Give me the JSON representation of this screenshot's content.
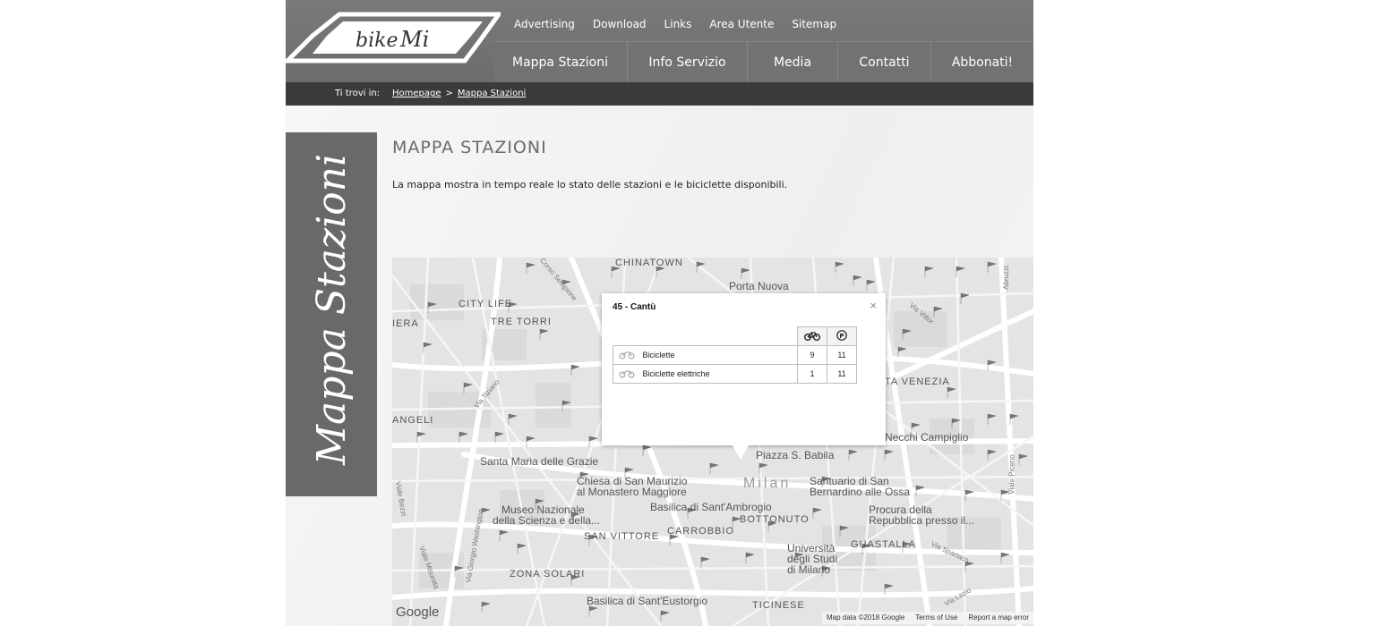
{
  "logo": {
    "text_bike": "bike",
    "text_mi": "Mi"
  },
  "top_nav": [
    "Advertising",
    "Download",
    "Links",
    "Area Utente",
    "Sitemap"
  ],
  "main_nav": [
    "Mappa Stazioni",
    "Info Servizio",
    "Media",
    "Contatti",
    "Abbonati!"
  ],
  "breadcrumb": {
    "label": "Ti trovi in:",
    "items": [
      "Homepage",
      "Mappa Stazioni"
    ],
    "separator": ">"
  },
  "side_banner": {
    "text": "Mappa Stazioni"
  },
  "page": {
    "title": "MAPPA STAZIONI",
    "intro": "La mappa mostra in tempo reale lo stato delle stazioni e le biciclette disponibili."
  },
  "map": {
    "labels": {
      "chinatown": "CHINATOWN",
      "porta_nuova": "Porta Nuova",
      "city_life": "CITY LIFE",
      "tre_torri": "TRE TORRI",
      "iera": "IERA",
      "porta_venezia": "TA VENEZIA",
      "angeli": "ANGELI",
      "necchi": "Necchi Campiglio",
      "santa_maria": "Santa Maria delle Grazie",
      "piazza_babila": "Piazza S. Babila",
      "chiesa_1": "Chiesa di San Maurizio",
      "chiesa_2": "al Monastero Maggiore",
      "milan": "Milan",
      "santuario_1": "Santuario di San",
      "santuario_2": "Bernardino alle Ossa",
      "museo_1": "Museo Nazionale",
      "museo_2": "della Scienza e della...",
      "basilica_ambrogio": "Basilica di Sant'Ambrogio",
      "bottonuto": "BOTTONUTO",
      "procura_1": "Procura della",
      "procura_2": "Repubblica presso il...",
      "san_vittore": "SAN VITTORE",
      "carrobbio": "CARROBBIO",
      "guastalla": "GUASTALLA",
      "universita_1": "Università",
      "universita_2": "degli Studi",
      "universita_3": "di Milano",
      "zona_solari": "ZONA SOLARI",
      "eustorgio": "Basilica di Sant'Eustorgio",
      "ticinese": "TICINESE",
      "via_tiziano": "Via Tiziano",
      "viale_misurata": "Viale Misurata",
      "via_washington": "Via Giorgio Washington",
      "piceno": "Viale Piceno",
      "via_abruzzi": "Abruzzi",
      "corso_sempione": "Corso Sempione",
      "via_spartaco": "Via Spartaco",
      "viale_bezzi": "Viale Bezzi",
      "vittorio_veneto": "Via Vittor",
      "via_lazio": "Via Lazio"
    },
    "google": "Google",
    "footer": [
      "Map data ©2018 Google",
      "Terms of Use",
      "Report a map error"
    ]
  },
  "popup": {
    "title": "45 - Cantù",
    "close": "×",
    "rows": [
      {
        "label": "Biciclette",
        "bikes": "9",
        "parking": "11"
      },
      {
        "label": "Biciclette elettriche",
        "bikes": "1",
        "parking": "11"
      }
    ]
  }
}
